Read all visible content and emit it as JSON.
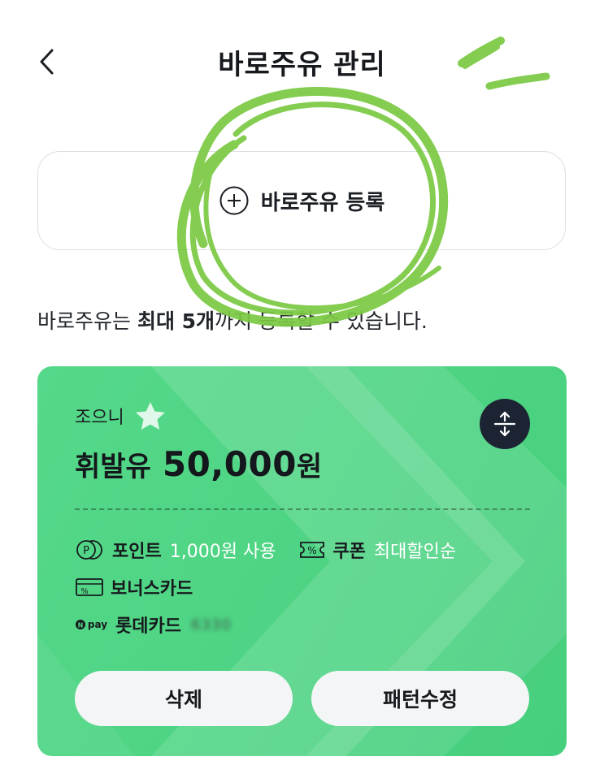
{
  "header": {
    "title": "바로주유 관리"
  },
  "register": {
    "label": "바로주유 등록"
  },
  "info": {
    "prefix": "바로주유는 ",
    "bold": "최대 5개",
    "suffix": "까지 등록할 수 있습니다."
  },
  "card": {
    "nickname": "조으니",
    "fuel_type": "휘발유",
    "amount": "50,000",
    "unit": "원",
    "point_label": "포인트",
    "point_value": "1,000원 사용",
    "coupon_label": "쿠폰",
    "coupon_value": "최대할인순",
    "bonus_label": "보너스카드",
    "npay_mark": "pay",
    "pay_label": "롯데카드",
    "pay_number": "6330",
    "delete_label": "삭제",
    "edit_label": "패턴수정",
    "colors": {
      "card": "#4dd483",
      "highlight": "#7ac943",
      "swap_button": "#1c2433"
    }
  },
  "icons": [
    "back-icon",
    "plus-circle-icon",
    "star-icon",
    "swap-icon",
    "point-icon",
    "coupon-icon",
    "bonus-card-icon",
    "npay-icon"
  ]
}
